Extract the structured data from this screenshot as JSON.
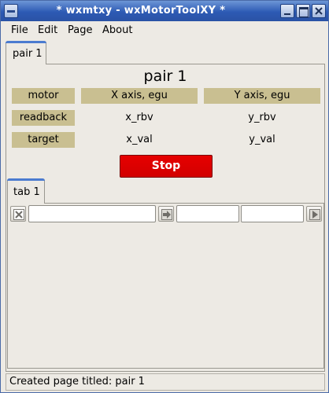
{
  "window": {
    "title": "* wxmtxy - wxMotorToolXY *"
  },
  "menubar": {
    "items": [
      {
        "label": "File"
      },
      {
        "label": "Edit"
      },
      {
        "label": "Page"
      },
      {
        "label": "About"
      }
    ]
  },
  "outer_notebook": {
    "active_tab": "pair 1"
  },
  "pair": {
    "title": "pair 1",
    "headers": {
      "motor": "motor",
      "x_axis": "X axis, egu",
      "y_axis": "Y axis, egu"
    },
    "rows": {
      "readback": {
        "label": "readback",
        "x": "x_rbv",
        "y": "y_rbv"
      },
      "target": {
        "label": "target",
        "x": "x_val",
        "y": "y_val"
      }
    },
    "stop_label": "Stop",
    "colors": {
      "header_bg": "#c9bf91",
      "stop_bg": "#e00000"
    }
  },
  "inner_notebook": {
    "active_tab": "tab 1",
    "row": {
      "name_value": "",
      "x_value": "",
      "y_value": "",
      "icons": [
        "delete-icon",
        "apply-icon",
        "play-icon"
      ]
    }
  },
  "status": {
    "text": "Created page titled: pair 1"
  }
}
